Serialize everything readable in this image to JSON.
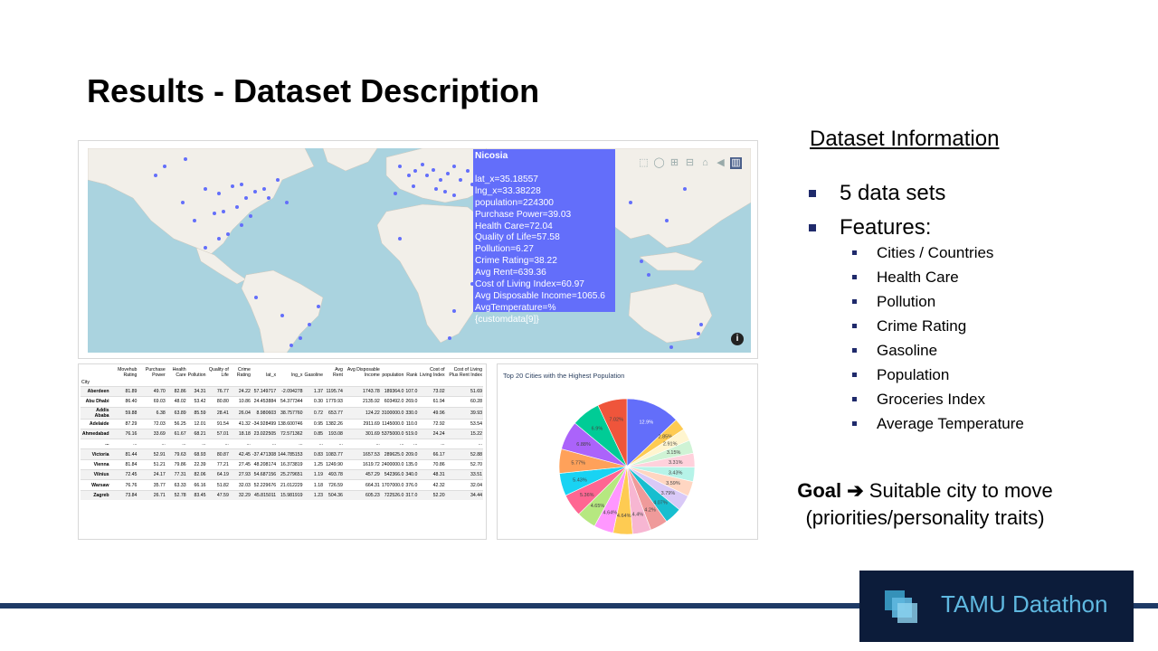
{
  "slide": {
    "title": "Results - Dataset Description"
  },
  "map": {
    "tooltip": {
      "title": "Nicosia",
      "lines": [
        "lat_x=35.18557",
        "lng_x=33.38228",
        "population=224300",
        "Purchase Power=39.03",
        "Health Care=72.04",
        "Quality of Life=57.58",
        "Pollution=6.27",
        "Crime Rating=38.22",
        "Avg Rent=639.36",
        "Cost of Living Index=60.97",
        "Avg Disposable Income=1065.6",
        "AvgTemperature=%{customdata[9]}"
      ]
    },
    "marker_color": "#636efa",
    "toolbar_icons": [
      "box-select-icon",
      "lasso-icon",
      "zoom-in-icon",
      "zoom-out-icon",
      "home-icon",
      "tag-icon",
      "plotly-logo-icon"
    ],
    "info_glyph": "i"
  },
  "table": {
    "index_name": "City",
    "columns": [
      "Movehub Rating",
      "Purchase Power",
      "Health Care",
      "Pollution",
      "Quality of Life",
      "Crime Rating",
      "lat_x",
      "lng_x",
      "Gasoline",
      "Avg Rent",
      "Avg Disposable Income",
      "population",
      "Rank",
      "Cost of Living Index",
      "Cost of Living Plus Rent Index"
    ],
    "rows": [
      {
        "city": "Aberdeen",
        "vals": [
          "81.89",
          "49.70",
          "82.86",
          "34.31",
          "76.77",
          "24.22",
          "57.149717",
          "-2.094278",
          "1.37",
          "1195.74",
          "1743.78",
          "189364.0",
          "107.0",
          "73.02",
          "51.69"
        ]
      },
      {
        "city": "Abu Dhabi",
        "vals": [
          "86.40",
          "69.03",
          "48.02",
          "53.42",
          "80.80",
          "10.86",
          "24.453884",
          "54.377344",
          "0.30",
          "1779.93",
          "2135.92",
          "603492.0",
          "269.0",
          "61.94",
          "60.28"
        ]
      },
      {
        "city": "Addis Ababa",
        "vals": [
          "59.88",
          "6.38",
          "63.89",
          "85.59",
          "28.41",
          "26.04",
          "8.980603",
          "38.757760",
          "0.72",
          "653.77",
          "124.22",
          "3100000.0",
          "330.0",
          "49.96",
          "39.93"
        ]
      },
      {
        "city": "Adelaide",
        "vals": [
          "87.29",
          "72.03",
          "56.25",
          "12.01",
          "91.54",
          "41.32",
          "-34.928499",
          "138.600746",
          "0.95",
          "1382.26",
          "2911.69",
          "1145000.0",
          "110.0",
          "72.92",
          "53.54"
        ]
      },
      {
        "city": "Ahmedabad",
        "vals": [
          "76.16",
          "33.69",
          "61.67",
          "68.21",
          "57.01",
          "18.18",
          "23.022505",
          "72.571362",
          "0.85",
          "193.08",
          "301.69",
          "5375000.0",
          "519.0",
          "24.24",
          "15.22"
        ]
      },
      {
        "city": "...",
        "vals": [
          "...",
          "...",
          "...",
          "...",
          "...",
          "...",
          "...",
          "...",
          "...",
          "...",
          "...",
          "...",
          "...",
          "...",
          "..."
        ]
      },
      {
        "city": "Victoria",
        "vals": [
          "81.44",
          "52.91",
          "79.63",
          "68.93",
          "80.87",
          "42.45",
          "-37.471308",
          "144.785153",
          "0.83",
          "1083.77",
          "1657.53",
          "289625.0",
          "209.0",
          "66.17",
          "52.88"
        ]
      },
      {
        "city": "Vienna",
        "vals": [
          "81.84",
          "51.21",
          "79.86",
          "22.39",
          "77.21",
          "27.45",
          "48.208174",
          "16.373819",
          "1.25",
          "1249.90",
          "1619.72",
          "2400000.0",
          "135.0",
          "70.86",
          "52.70"
        ]
      },
      {
        "city": "Vilnius",
        "vals": [
          "72.45",
          "24.17",
          "77.31",
          "82.06",
          "64.19",
          "27.93",
          "54.687156",
          "25.279651",
          "1.19",
          "493.78",
          "457.29",
          "542366.0",
          "340.0",
          "48.31",
          "33.51"
        ]
      },
      {
        "city": "Warsaw",
        "vals": [
          "76.76",
          "35.77",
          "63.33",
          "66.16",
          "51.82",
          "32.03",
          "52.229676",
          "21.012229",
          "1.18",
          "726.59",
          "664.31",
          "1707000.0",
          "376.0",
          "42.32",
          "32.04"
        ]
      },
      {
        "city": "Zagreb",
        "vals": [
          "73.84",
          "26.71",
          "52.78",
          "83.45",
          "47.59",
          "32.29",
          "45.815011",
          "15.981919",
          "1.23",
          "504.36",
          "605.23",
          "722526.0",
          "317.0",
          "52.20",
          "34.44"
        ]
      }
    ]
  },
  "chart_data": {
    "type": "pie",
    "title": "Top 20 Cities with the Highest Population",
    "slices": [
      {
        "value": 12.9,
        "label": "12.9%",
        "color": "#636efa"
      },
      {
        "value": 2.85,
        "label": "2.85%",
        "color": "#fecb52"
      },
      {
        "value": 2.91,
        "label": "2.91%",
        "color": "#fff5cf"
      },
      {
        "value": 3.15,
        "label": "3.15%",
        "color": "#cff3d5"
      },
      {
        "value": 3.31,
        "label": "3.31%",
        "color": "#ffd1dc"
      },
      {
        "value": 3.43,
        "label": "3.43%",
        "color": "#b6f3e8"
      },
      {
        "value": 3.59,
        "label": "3.59%",
        "color": "#ffd6c2"
      },
      {
        "value": 3.79,
        "label": "3.79%",
        "color": "#d9c9f7"
      },
      {
        "value": 4.07,
        "label": "4.07%",
        "color": "#17becf"
      },
      {
        "value": 4.2,
        "label": "4.2%",
        "color": "#ef9a9a"
      },
      {
        "value": 4.4,
        "label": "4.4%",
        "color": "#f7b6d2"
      },
      {
        "value": 4.64,
        "label": "4.64%",
        "color": "#fecb52"
      },
      {
        "value": 4.64,
        "label": "4.64%",
        "color": "#ff97ff"
      },
      {
        "value": 4.65,
        "label": "4.65%",
        "color": "#b6e880"
      },
      {
        "value": 5.36,
        "label": "5.36%",
        "color": "#ff6692"
      },
      {
        "value": 5.43,
        "label": "5.43%",
        "color": "#19d3f3"
      },
      {
        "value": 5.77,
        "label": "5.77%",
        "color": "#ffa15a"
      },
      {
        "value": 6.88,
        "label": "6.88%",
        "color": "#ab63fa"
      },
      {
        "value": 6.9,
        "label": "6.9%",
        "color": "#00cc96"
      },
      {
        "value": 7.02,
        "label": "7.02%",
        "color": "#ef553b"
      }
    ]
  },
  "dataset_info": {
    "heading": "Dataset Information",
    "bullets": [
      "5 data sets",
      "Features:"
    ],
    "features": [
      "Cities / Countries",
      "Health Care",
      "Pollution",
      "Crime Rating",
      "Gasoline",
      "Population",
      "Groceries Index",
      "Average Temperature"
    ]
  },
  "goal": {
    "label": "Goal",
    "arrow": "➔",
    "text_line1": "Suitable city to move",
    "text_line2": "(priorities/personality traits)"
  },
  "footer": {
    "logo_text": "TAMU Datathon",
    "logo_color": "#5fb8e0"
  }
}
